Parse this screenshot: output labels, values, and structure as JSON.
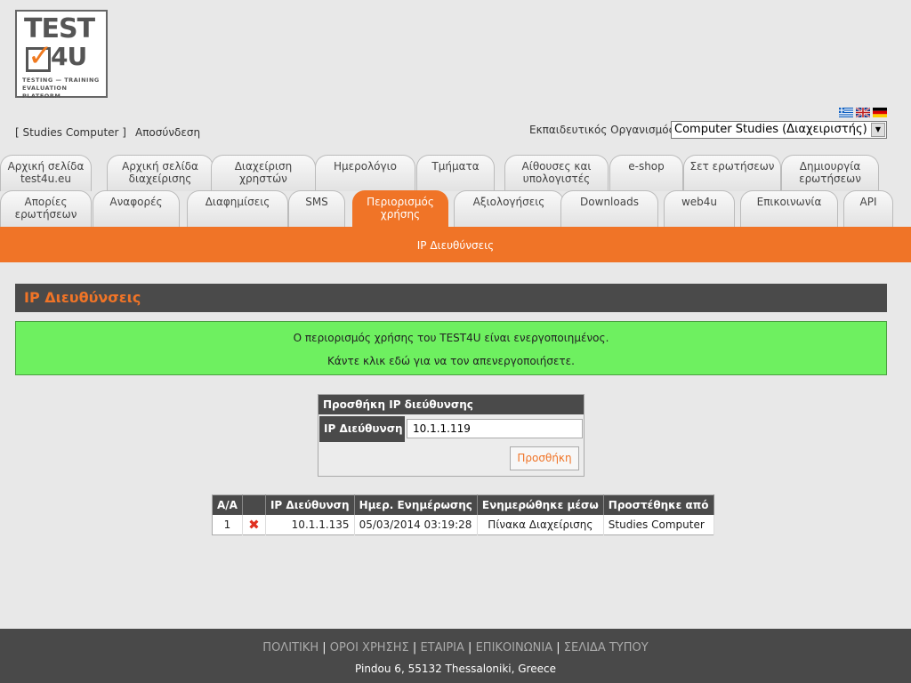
{
  "logo": {
    "line1": "TEST",
    "line2": "4U",
    "tagline1": "TESTING — TRAINING",
    "tagline2": "EVALUATION PLATFORM"
  },
  "header": {
    "user_link": "[ Studies Computer ]",
    "logout": "Αποσύνδεση",
    "org_label": "Εκπαιδευτικός Οργανισμός:",
    "org_value": "Computer Studies (Διαχειριστής)",
    "languages": [
      "greek-flag-icon",
      "uk-flag-icon",
      "german-flag-icon"
    ]
  },
  "tabs_row1": [
    {
      "label": "Αρχική σελίδα test4u.eu"
    },
    {
      "label": "Αρχική σελίδα διαχείρισης"
    },
    {
      "label": "Διαχείριση χρηστών"
    },
    {
      "label": "Ημερολόγιο"
    },
    {
      "label": "Τμήματα"
    },
    {
      "label": "Αίθουσες και υπολογιστές"
    },
    {
      "label": "e-shop"
    },
    {
      "label": "Σετ ερωτήσεων"
    },
    {
      "label": "Δημιουργία ερωτήσεων"
    }
  ],
  "tabs_row2": [
    {
      "label": "Απορίες ερωτήσεων"
    },
    {
      "label": "Αναφορές"
    },
    {
      "label": "Διαφημίσεις"
    },
    {
      "label": "SMS"
    },
    {
      "label": "Περιορισμός χρήσης"
    },
    {
      "label": "Αξιολογήσεις"
    },
    {
      "label": "Downloads"
    },
    {
      "label": "web4u"
    },
    {
      "label": "Επικοινωνία"
    },
    {
      "label": "API"
    }
  ],
  "subnav": {
    "item": "IP Διευθύνσεις"
  },
  "section": {
    "title": "IP Διευθύνσεις"
  },
  "notice": {
    "line1": "Ο περιορισμός χρήσης του TEST4U είναι ενεργοποιημένος.",
    "line2": "Κάντε κλικ εδώ για να τον απενεργοποιήσετε."
  },
  "add_form": {
    "title": "Προσθήκη IP διεύθυνσης",
    "label": "IP Διεύθυνση",
    "value": "10.1.1.119",
    "button": "Προσθήκη"
  },
  "table": {
    "headers": [
      "Α/Α",
      "",
      "IP Διεύθυνση",
      "Ημερ. Ενημέρωσης",
      "Ενημερώθηκε μέσω",
      "Προστέθηκε από"
    ],
    "rows": [
      {
        "num": "1",
        "ip": "10.1.1.135",
        "date": "05/03/2014 03:19:28",
        "via": "Πίνακα Διαχείρισης",
        "by": "Studies Computer"
      }
    ]
  },
  "footer": {
    "links": [
      "ΠΟΛΙΤΙΚΗ",
      "ΟΡΟΙ ΧΡΗΣΗΣ",
      "ΕΤΑΙΡΙΑ",
      "ΕΠΙΚΟΙΝΩΝΙΑ",
      "ΣΕΛΙΔΑ ΤΥΠΟΥ"
    ],
    "separator": "|",
    "address": "Pindou 6, 55132 Thessaloniki, Greece"
  },
  "colors": {
    "accent": "#f07427",
    "dark": "#4a4a4a",
    "notice_bg": "#6ef060",
    "background": "#e8e8e8"
  }
}
